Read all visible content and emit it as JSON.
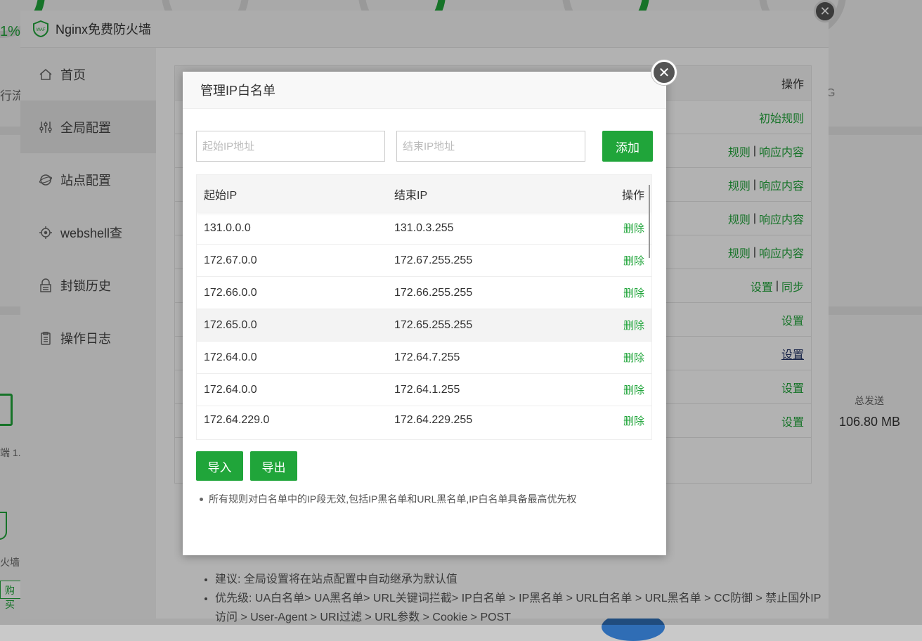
{
  "background": {
    "stat_pct": "1%",
    "flow_text": "行流",
    "g_text": "G",
    "client_text": "端 1.",
    "firewall_text": "火墙",
    "buy_label": "购买",
    "total_send_label": "总发送",
    "total_send_value": "106.80 MB"
  },
  "window": {
    "title": "Nginx免费防火墙",
    "logo_text": "WAF",
    "close_glyph": "✕"
  },
  "sidebar": {
    "items": [
      {
        "label": "首页",
        "icon": "home-icon"
      },
      {
        "label": "全局配置",
        "icon": "sliders-icon"
      },
      {
        "label": "站点配置",
        "icon": "globe-icon"
      },
      {
        "label": "webshell查",
        "icon": "target-icon"
      },
      {
        "label": "封锁历史",
        "icon": "lock-history-icon"
      },
      {
        "label": "操作日志",
        "icon": "clipboard-icon"
      }
    ]
  },
  "config_table": {
    "header_action": "操作",
    "rows": [
      {
        "a": "初始规则"
      },
      {
        "a": "规则",
        "b": "响应内容"
      },
      {
        "a": "规则",
        "b": "响应内容"
      },
      {
        "a": "规则",
        "b": "响应内容"
      },
      {
        "a": "规则",
        "b": "响应内容"
      },
      {
        "a": "设置",
        "b": "同步"
      },
      {
        "a": "设置"
      },
      {
        "a": "设置"
      },
      {
        "a": "设置"
      },
      {
        "a": "设置"
      }
    ]
  },
  "notes": {
    "line1": "建议: 全局设置将在站点配置中自动继承为默认值",
    "line2": "优先级: UA白名单> UA黑名单> URL关键词拦截> IP白名单 > IP黑名单 > URL白名单 > URL黑名单 > CC防御 > 禁止国外IP访问 > User-Agent > URI过滤 > URL参数 > Cookie > POST"
  },
  "dialog": {
    "title": "管理IP白名单",
    "close_glyph": "✕",
    "start_placeholder": "起始IP地址",
    "end_placeholder": "结束IP地址",
    "add_label": "添加",
    "columns": {
      "start": "起始IP",
      "end": "结束IP",
      "action": "操作"
    },
    "rows": [
      {
        "start": "131.0.0.0",
        "end": "131.0.3.255",
        "action": "删除"
      },
      {
        "start": "172.67.0.0",
        "end": "172.67.255.255",
        "action": "删除"
      },
      {
        "start": "172.66.0.0",
        "end": "172.66.255.255",
        "action": "删除"
      },
      {
        "start": "172.65.0.0",
        "end": "172.65.255.255",
        "action": "删除"
      },
      {
        "start": "172.64.0.0",
        "end": "172.64.7.255",
        "action": "删除"
      },
      {
        "start": "172.64.0.0",
        "end": "172.64.1.255",
        "action": "删除"
      },
      {
        "start": "172.64.229.0",
        "end": "172.64.229.255",
        "action": "删除"
      }
    ],
    "import_label": "导入",
    "export_label": "导出",
    "tip": "所有规则对白名单中的IP段无效,包括IP黑名单和URL黑名单,IP白名单具备最高优先权"
  },
  "colors": {
    "accent": "#20a53a",
    "overlay": "rgba(0,0,0,0.3)"
  }
}
